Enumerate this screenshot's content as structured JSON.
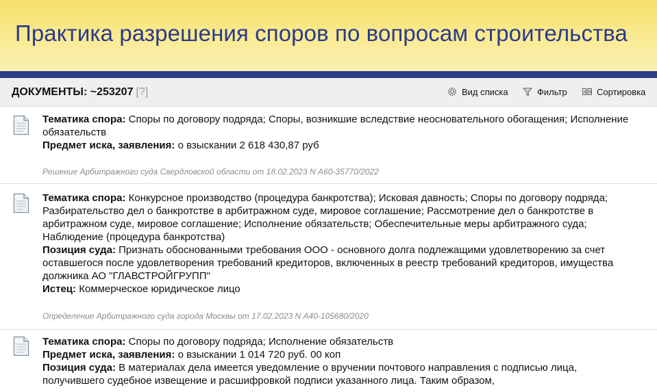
{
  "banner": {
    "title": "Практика разрешения споров по вопросам строительства"
  },
  "toolbar": {
    "count_label": "ДОКУМЕНТЫ: ~253207",
    "help": "[?]",
    "view_label": "Вид списка",
    "filter_label": "Фильтр",
    "sort_label": "Сортировка"
  },
  "documents": [
    {
      "fields": [
        {
          "label": "Тематика спора:",
          "text": "Споры по договору подряда; Споры, возникшие вследствие неосновательного обогащения; Исполнение обязательств"
        },
        {
          "label": "Предмет иска, заявления:",
          "text": "о взыскании 2 618 430,87 руб"
        }
      ],
      "source": "Решение Арбитражного суда Свердловской области от 18.02.2023 N А60-35770/2022"
    },
    {
      "fields": [
        {
          "label": "Тематика спора:",
          "text": "Конкурсное производство (процедура банкротства); Исковая давность; Споры по договору подряда; Разбирательство дел о банкротстве в арбитражном суде, мировое соглашение; Рассмотрение дел о банкротстве в арбитражном суде, мировое соглашение; Исполнение обязательств; Обеспечительные меры арбитражного суда; Наблюдение (процедура банкротства)"
        },
        {
          "label": "Позиция суда:",
          "text": "Признать обоснованными требования ООО - основного долга подлежащими удовлетворению за счет оставшегося после удовлетворения требований кредиторов, включенных в реестр требований кредиторов, имущества должника АО \"ГЛАВСТРОЙГРУПП\""
        },
        {
          "label": "Истец:",
          "text": "Коммерческое юридическое лицо"
        }
      ],
      "source": "Определение Арбитражного суда города Москвы от 17.02.2023 N А40-105680/2020"
    },
    {
      "fields": [
        {
          "label": "Тематика спора:",
          "text": "Споры по договору подряда; Исполнение обязательств"
        },
        {
          "label": "Предмет иска, заявления:",
          "text": "о взыскании 1 014 720 руб. 00 коп"
        },
        {
          "label": "Позиция суда:",
          "text": "В материалах дела имеется уведомление о вручении почтового направления с подписью лица, получившего судебное извещение и расшифровкой подписи указанного лица. Таким образом,"
        }
      ],
      "source": ""
    }
  ]
}
